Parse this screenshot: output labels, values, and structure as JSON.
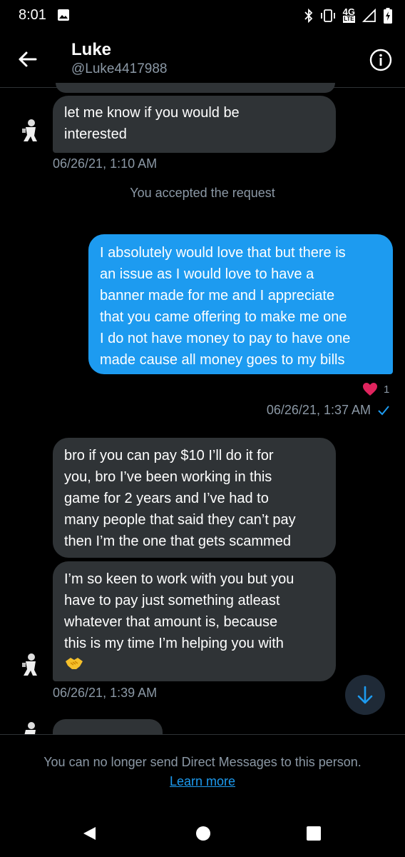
{
  "status_bar": {
    "time": "8:01",
    "network": "4G",
    "network_sub": "LTE"
  },
  "header": {
    "name": "Luke",
    "handle": "@Luke4417988"
  },
  "messages": {
    "m1": {
      "lines": [
        "let me know if you would be",
        "interested"
      ],
      "timestamp": "06/26/21, 1:10 AM"
    },
    "system": "You accepted the request",
    "m2": {
      "lines": [
        "I absolutely would love that but there is",
        "an issue as I would love to have a",
        "banner made for me and I appreciate",
        "that you came offering to make me one",
        "I do not have money to pay to have one",
        "made cause all money goes to my bills"
      ],
      "reaction_count": "1",
      "timestamp": "06/26/21, 1:37 AM"
    },
    "m3": {
      "lines": [
        "bro if you can pay $10 I’ll do it for",
        "you, bro I’ve been working in this",
        "game for 2 years and I’ve had to",
        "many people that said they can’t pay",
        "then I’m the one that gets scammed"
      ]
    },
    "m4": {
      "lines": [
        "I’m so keen to work with you but you",
        "have to pay just something atleast",
        "whatever that amount is, because",
        "this is my time I’m helping you with"
      ],
      "timestamp": "06/26/21, 1:39 AM"
    }
  },
  "footer": {
    "notice": "You can no longer send Direct Messages to this person.",
    "learn_more": "Learn more"
  },
  "colors": {
    "accent": "#1d9bf0",
    "bubble_in": "#2f3336",
    "background": "#000000"
  },
  "icons": [
    "image-icon",
    "bluetooth-icon",
    "vibrate-icon",
    "signal-icon",
    "battery-icon",
    "back-arrow-icon",
    "info-icon",
    "heart-icon",
    "check-icon",
    "handshake-icon",
    "scroll-down-icon",
    "nav-back-icon",
    "nav-home-icon",
    "nav-recents-icon"
  ]
}
